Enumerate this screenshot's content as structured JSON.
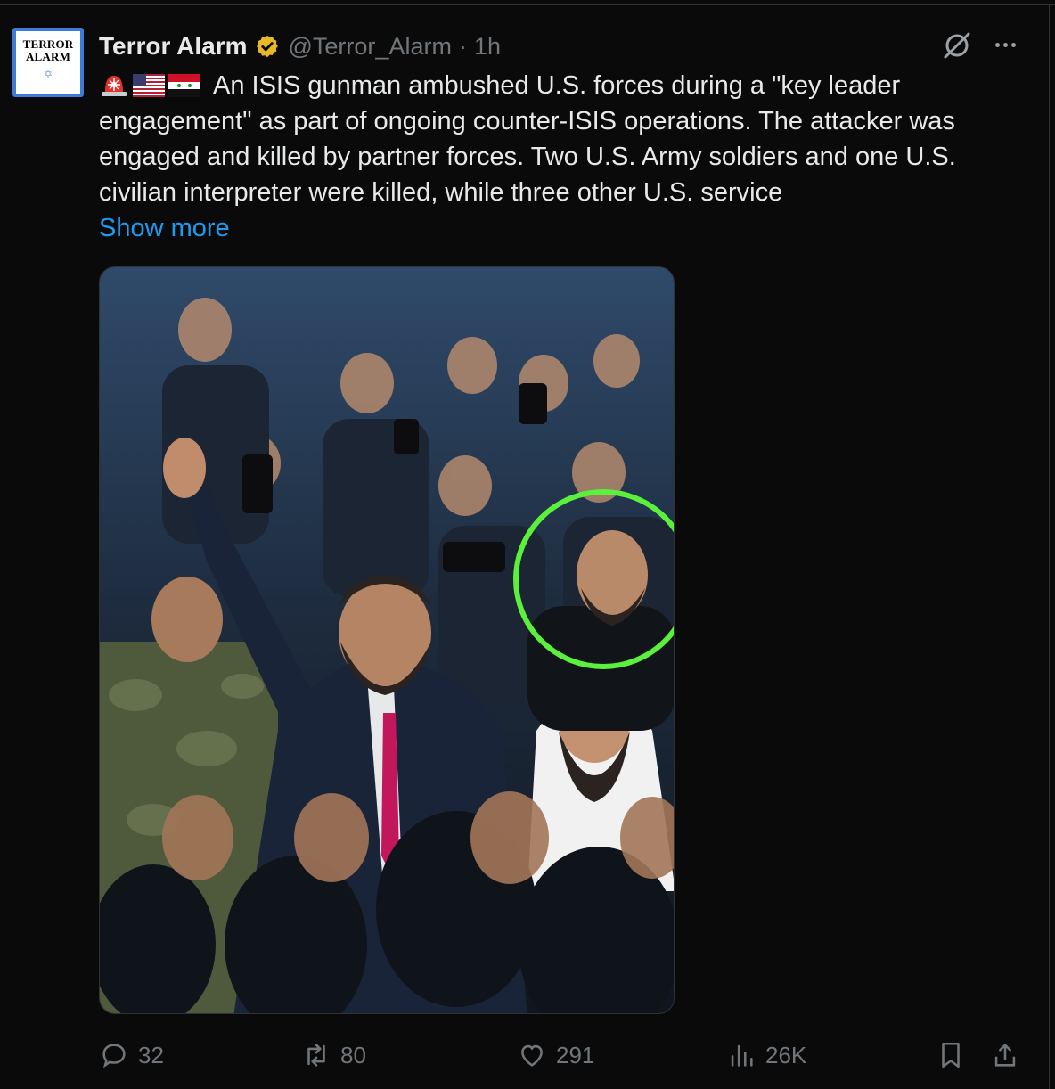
{
  "author": {
    "avatar_text": [
      "TERROR",
      "ALARM"
    ],
    "name": "Terror Alarm",
    "handle": "@Terror_Alarm",
    "separator": "·",
    "time": "1h",
    "verified_badge_color": "#e8b828"
  },
  "tweet": {
    "emojis": [
      "rotating-light-emoji",
      "us-flag-emoji",
      "syria-flag-emoji"
    ],
    "lines": [
      "An ISIS gunman ambushed U.S. forces during a \"key leader",
      "engagement\" as part of ongoing counter-ISIS operations. The attacker was",
      "engaged and killed by partner forces. Two U.S. Army soldiers and one U.S.",
      "civilian interpreter were killed, while three other U.S. service"
    ],
    "show_more": "Show more"
  },
  "media": {
    "description_icon": "crowd-photo",
    "highlight_color": "#5bf03c"
  },
  "actions": {
    "replies": "32",
    "reposts": "80",
    "likes": "291",
    "views": "26K"
  },
  "colors": {
    "background": "#0a0a0a",
    "text": "#e7e9ea",
    "muted": "#71767b",
    "link": "#1d9bf0"
  }
}
